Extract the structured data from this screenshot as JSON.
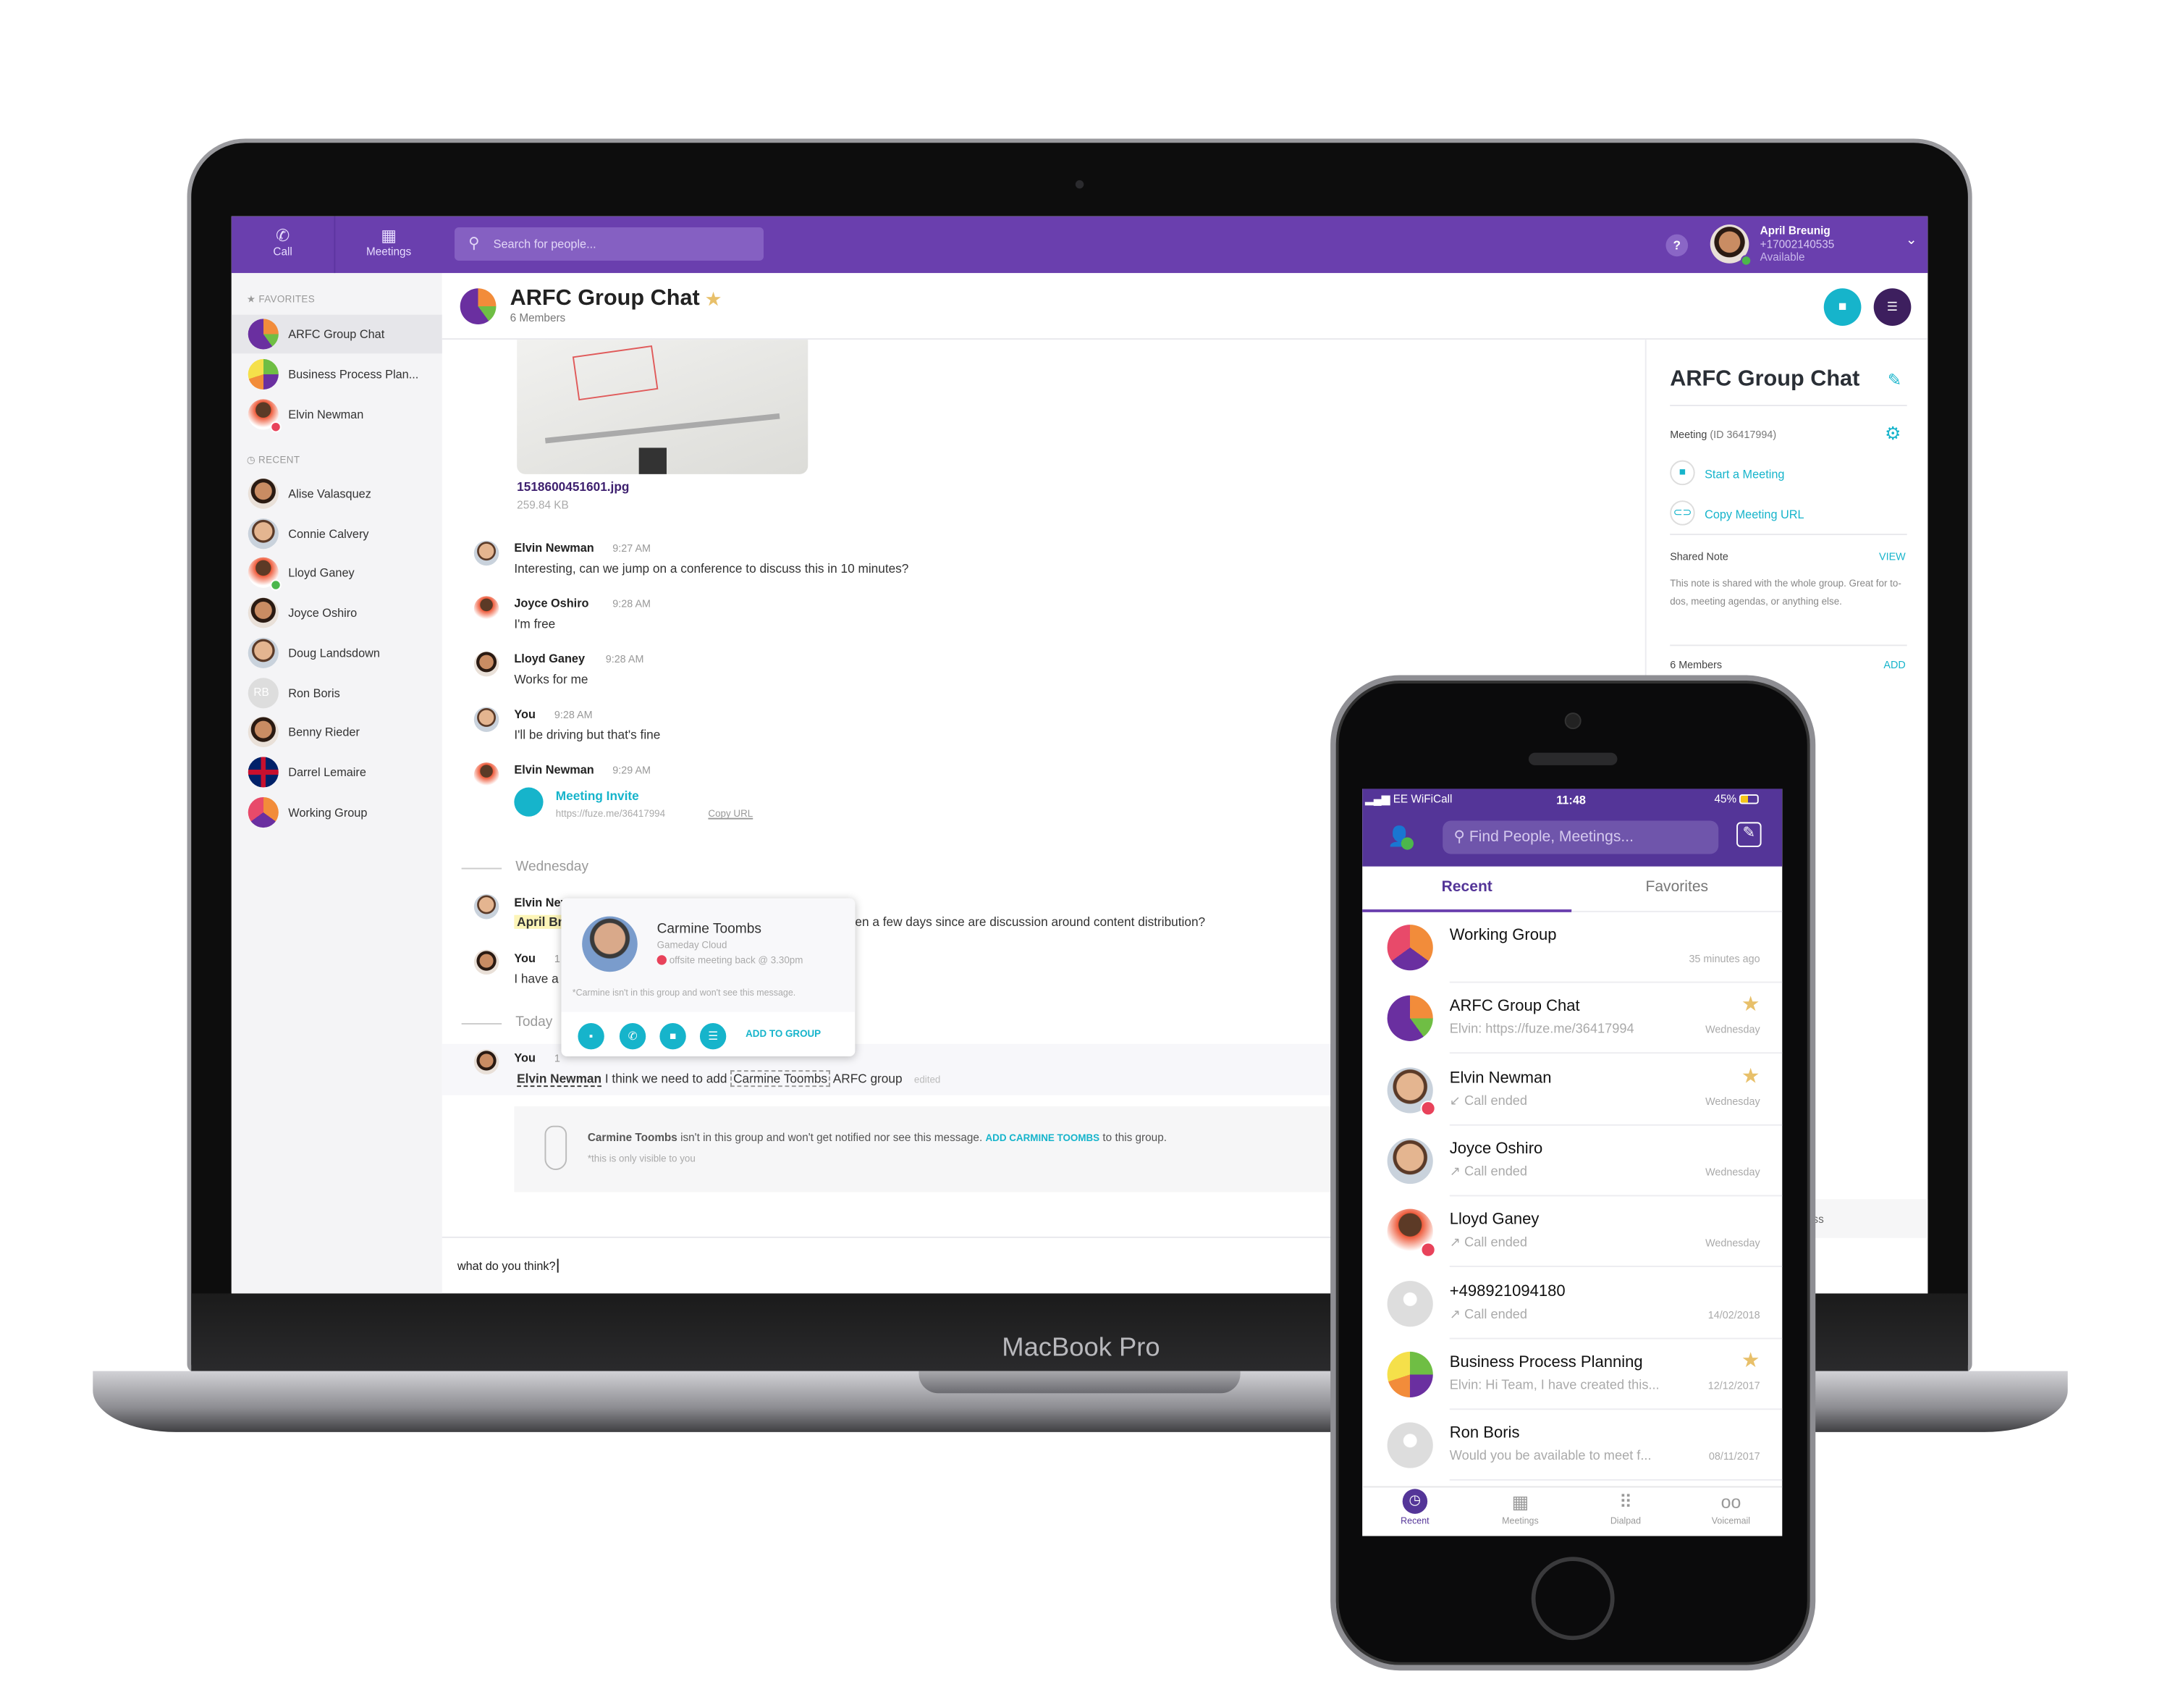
{
  "colors": {
    "brand_purple": "#6a3fae",
    "accent_teal": "#16b4cb",
    "dark_purple": "#3d1f5e",
    "star": "#e8c06a",
    "busy": "#e8425a",
    "available": "#4cb74c"
  },
  "device": {
    "laptop_label": "MacBook Pro"
  },
  "topbar": {
    "call_label": "Call",
    "meetings_label": "Meetings",
    "search_placeholder": "Search for people...",
    "help_label": "?",
    "user": {
      "name": "April Breunig",
      "phone": "+17002140535",
      "status": "Available"
    }
  },
  "sidebar": {
    "favorites_label": "FAVORITES",
    "recent_label": "RECENT",
    "favorites": [
      {
        "label": "ARFC Group Chat",
        "avatar": "group"
      },
      {
        "label": "Business Process Plan...",
        "avatar": "group2"
      },
      {
        "label": "Elvin Newman",
        "avatar": "photo",
        "status": "busy"
      }
    ],
    "recent": [
      {
        "label": "Alise Valasquez"
      },
      {
        "label": "Connie Calvery"
      },
      {
        "label": "Lloyd Ganey",
        "status": "available"
      },
      {
        "label": "Joyce Oshiro"
      },
      {
        "label": "Doug Landsdown"
      },
      {
        "label": "Ron Boris",
        "initials": "RB"
      },
      {
        "label": "Benny Rieder"
      },
      {
        "label": "Darrel Lemaire"
      },
      {
        "label": "Working Group"
      }
    ]
  },
  "chat": {
    "title": "ARFC Group Chat",
    "members": "6 Members",
    "attachment": {
      "filename": "1518600451601.jpg",
      "size": "259.84 KB"
    },
    "messages": [
      {
        "author": "Elvin Newman",
        "time": "9:27 AM",
        "text": "Interesting, can we jump on a conference to discuss this in 10 minutes?"
      },
      {
        "author": "Joyce Oshiro",
        "time": "9:28 AM",
        "text": "I'm free"
      },
      {
        "author": "Lloyd Ganey",
        "time": "9:28 AM",
        "text": "Works for me"
      },
      {
        "author": "You",
        "time": "9:28 AM",
        "text": "I'll be driving but that's fine"
      },
      {
        "author": "Elvin Newman",
        "time": "9:29 AM",
        "invite_title": "Meeting Invite",
        "invite_url": "https://fuze.me/36417994",
        "copy_url": "Copy URL"
      }
    ],
    "divider_wednesday": "Wednesday",
    "wed_msg1": {
      "author": "Elvin Nev",
      "mention": "April Br",
      "text_tail": "en a few days since are discussion around content distribution?"
    },
    "wed_msg2": {
      "author": "You",
      "time": "1",
      "text": "I have a"
    },
    "divider_today": "Today",
    "today_msg": {
      "author": "You",
      "time": "1",
      "mention": "Elvin Newman",
      "text1": "I think we need to add",
      "mention2": "Carmine Toombs",
      "text2": "ARFC group",
      "edited": "edited"
    },
    "notice": {
      "name": "Carmine Toombs",
      "text": "isn't in this group and won't get notified nor see this message.",
      "action": "ADD CARMINE TOOMBS",
      "tail": "to this group.",
      "footnote": "*this is only visible to you"
    },
    "composer_value": "what do you think?"
  },
  "popup": {
    "name": "Carmine Toombs",
    "company": "Gameday Cloud",
    "status": "offsite meeting back @ 3.30pm",
    "note": "*Carmine isn't in this group and won't see this message.",
    "add_label": "ADD TO GROUP"
  },
  "right_panel": {
    "title": "ARFC Group Chat",
    "meeting_label": "Meeting",
    "meeting_id": "(ID 36417994)",
    "start_meeting": "Start a Meeting",
    "copy_url": "Copy Meeting URL",
    "shared_note_label": "Shared Note",
    "view_label": "VIEW",
    "note_text": "This note is shared with the whole group. Great for to-dos, meeting agendas, or anything else.",
    "members_label": "6 Members",
    "add_label": "ADD",
    "cut_text": "ss"
  },
  "phone": {
    "carrier": "EE WiFiCall",
    "time": "11:48",
    "battery": "45%",
    "search_placeholder": "Find People, Meetings...",
    "tabs": [
      {
        "label": "Recent",
        "active": true
      },
      {
        "label": "Favorites",
        "active": false
      }
    ],
    "rows": [
      {
        "name": "Working Group",
        "sub": "",
        "date": "35 minutes ago",
        "star": false,
        "avatar": "group3"
      },
      {
        "name": "ARFC Group Chat",
        "sub": "Elvin: https://fuze.me/36417994",
        "date": "Wednesday",
        "star": true,
        "avatar": "group"
      },
      {
        "name": "Elvin Newman",
        "sub": "↙  Call ended",
        "date": "Wednesday",
        "star": true,
        "avatar": "photo",
        "status": "busy"
      },
      {
        "name": "Joyce Oshiro",
        "sub": "↗  Call ended",
        "date": "Wednesday",
        "star": false,
        "avatar": "photo"
      },
      {
        "name": "Lloyd Ganey",
        "sub": "↗  Call ended",
        "date": "Wednesday",
        "star": false,
        "avatar": "photo3",
        "status": "busy"
      },
      {
        "name": "+498921094180",
        "sub": "↗  Call ended",
        "date": "14/02/2018",
        "star": false,
        "avatar": "blank"
      },
      {
        "name": "Business Process Planning",
        "sub": "Elvin: Hi Team, I have created this...",
        "date": "12/12/2017",
        "star": true,
        "avatar": "group2"
      },
      {
        "name": "Ron Boris",
        "sub": "Would you be available to meet f...",
        "date": "08/11/2017",
        "star": false,
        "avatar": "blank"
      }
    ],
    "bottom_tabs": [
      {
        "label": "Recent",
        "icon": "clock-icon"
      },
      {
        "label": "Meetings",
        "icon": "calendar-icon"
      },
      {
        "label": "Dialpad",
        "icon": "dialpad-icon"
      },
      {
        "label": "Voicemail",
        "icon": "voicemail-icon"
      }
    ]
  }
}
